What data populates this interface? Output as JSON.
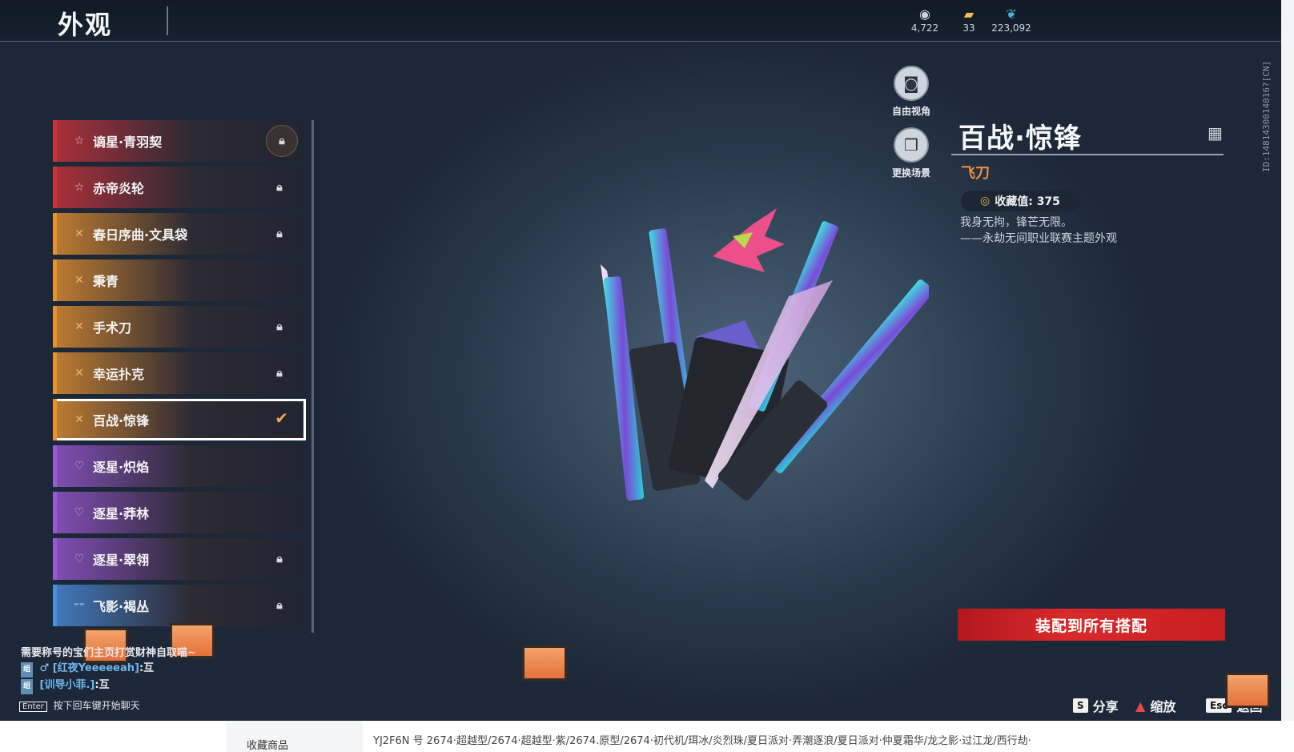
{
  "header": {
    "title": "外观",
    "currencies": [
      {
        "icon": "coin-stack-icon",
        "value": "4,722"
      },
      {
        "icon": "ticket-icon",
        "value": "33"
      },
      {
        "icon": "feather-icon",
        "value": "223,092"
      }
    ],
    "id_text": "ID:1481430014016?[CN]"
  },
  "items": [
    {
      "label": "谪星·青羽契",
      "color": "#d0323a",
      "icon": "star-icon",
      "locked": true
    },
    {
      "label": "赤帝炎轮",
      "color": "#d0323a",
      "icon": "star-icon",
      "locked": true
    },
    {
      "label": "春日序曲·文具袋",
      "color": "#e8922f",
      "icon": "cross-icon",
      "locked": true
    },
    {
      "label": "秉青",
      "color": "#e8922f",
      "icon": "cross-icon",
      "locked": false
    },
    {
      "label": "手术刀",
      "color": "#e8922f",
      "icon": "cross-icon",
      "locked": true
    },
    {
      "label": "幸运扑克",
      "color": "#e8922f",
      "icon": "cross-icon",
      "locked": true
    },
    {
      "label": "百战·惊锋",
      "color": "#e8922f",
      "icon": "cross-icon",
      "locked": false,
      "selected": true
    },
    {
      "label": "逐星·炽焰",
      "color": "#9b58d6",
      "icon": "heart-icon",
      "locked": false
    },
    {
      "label": "逐星·莽林",
      "color": "#9b58d6",
      "icon": "heart-icon",
      "locked": false
    },
    {
      "label": "逐星·翠翎",
      "color": "#9b58d6",
      "icon": "heart-icon",
      "locked": true
    },
    {
      "label": "飞影·褐丛",
      "color": "#4a8fe0",
      "icon": "wing-icon",
      "locked": true
    }
  ],
  "view": {
    "free_camera": "自由视角",
    "change_scene": "更换场景"
  },
  "detail": {
    "title": "百战·惊锋",
    "category": "飞刀",
    "collect_label": "收藏值: 375",
    "desc_line1": "我身无拘，锋芒无限。",
    "desc_line2": "——永劫无间职业联赛主题外观",
    "equip_button": "装配到所有搭配"
  },
  "hints": {
    "share_key": "S",
    "share": "分享",
    "zoom": "缩放",
    "back_key": "Esc",
    "back": "返回"
  },
  "chat": {
    "line1": "需要称号的宝们主页打赏财神自取喵~",
    "line2_user": "[红夜Yeeeeeah]",
    "line2_msg": ":互",
    "line3_user": "[训导小菲.]",
    "line3_msg": ":互",
    "enter_key": "Enter",
    "enter_hint": "按下回车键开始聊天"
  },
  "browser": {
    "left_tab": "收藏商品",
    "product_text": "YJ2F6N 号 2674·超越型/2674·超越型·紫/2674.原型/2674·初代机/珥冰/炎烈珠/夏日派对·弄潮逐浪/夏日派对·仲夏霜华/龙之影·过江龙/西行劫·"
  }
}
